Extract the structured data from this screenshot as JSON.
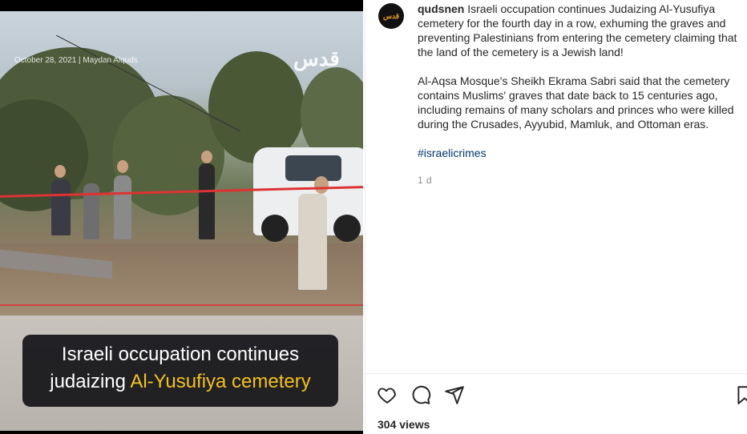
{
  "video": {
    "watermark": "October 28, 2021 | Maydan Alquds",
    "logo_text": "قدس",
    "caption_line1": "Israeli occupation continues",
    "caption_line2_prefix": "judaizing ",
    "caption_line2_highlight": "Al-Yusufiya cemetery"
  },
  "post": {
    "avatar_text": "قدس",
    "username": "qudsnen",
    "paragraph1": "Israeli occupation continues Judaizing Al-Yusufiya cemetery for the fourth day in a row, exhuming the graves and preventing Palestinians from entering the cemetery claiming that the land of the cemetery is a Jewish land!",
    "paragraph2": "Al-Aqsa Mosque's Sheikh Ekrama Sabri said that the cemetery contains Muslims' graves that date back to 15 centuries ago, including remains of many scholars and princes who were killed during the Crusades, Ayyubid, Mamluk, and Ottoman eras.",
    "hashtag": "#israelicrimes",
    "timestamp": "1 d"
  },
  "actions": {
    "icons": [
      "heart-icon",
      "comment-icon",
      "share-icon",
      "bookmark-icon"
    ]
  },
  "stats": {
    "views": "304 views"
  },
  "colors": {
    "caption_highlight": "#f6c21b",
    "hashtag": "#00376b",
    "text": "#262626",
    "muted": "#8e8e8e"
  }
}
